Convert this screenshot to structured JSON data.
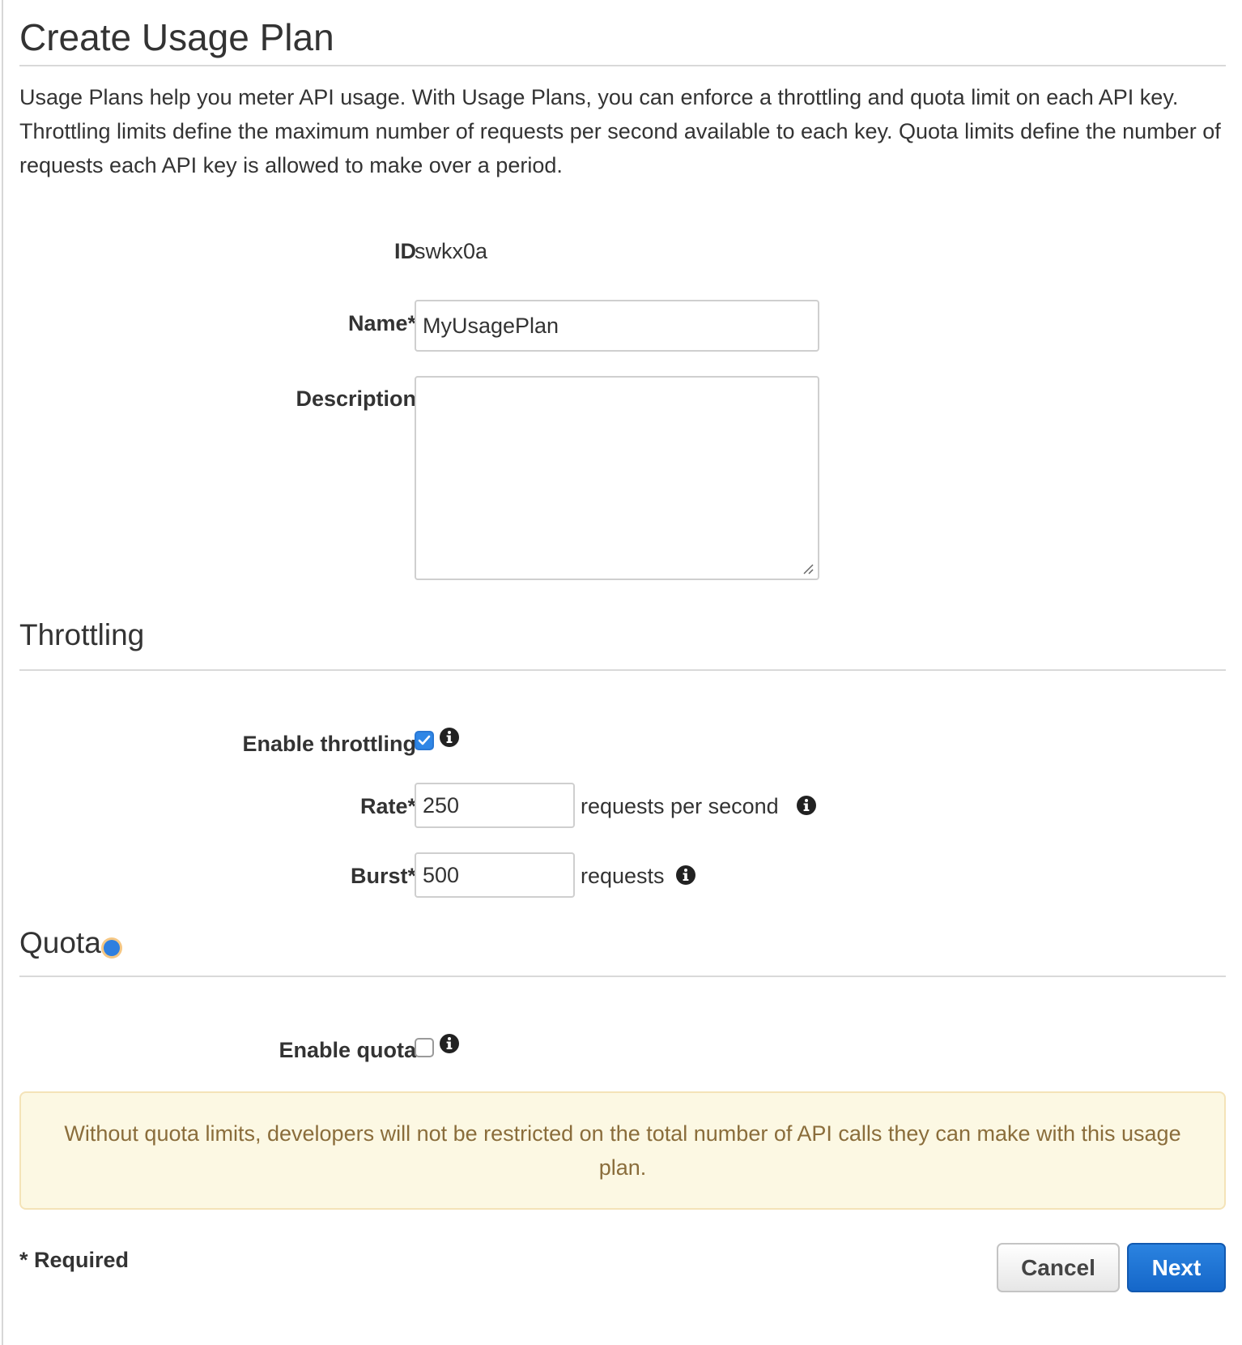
{
  "page": {
    "title": "Create Usage Plan",
    "intro": "Usage Plans help you meter API usage. With Usage Plans, you can enforce a throttling and quota limit on each API key. Throttling limits define the maximum number of requests per second available to each key. Quota limits define the number of requests each API key is allowed to make over a period."
  },
  "details": {
    "id_label": "ID",
    "id_value": "swkx0a",
    "name_label": "Name*",
    "name_value": "MyUsagePlan",
    "description_label": "Description",
    "description_value": ""
  },
  "throttling": {
    "title": "Throttling",
    "enable_label": "Enable throttling",
    "enabled": true,
    "rate_label": "Rate*",
    "rate_value": "250",
    "rate_suffix": "requests per second",
    "burst_label": "Burst*",
    "burst_value": "500",
    "burst_suffix": "requests"
  },
  "quota": {
    "title": "Quota",
    "enable_label": "Enable quota",
    "enabled": false,
    "warning": "Without quota limits, developers will not be restricted on the total number of API calls they can make with this usage plan."
  },
  "footer": {
    "required_note": "* Required",
    "cancel_label": "Cancel",
    "next_label": "Next"
  },
  "colors": {
    "primary_button": "#1a6fd1",
    "checkbox_checked": "#2f86e6",
    "warning_background": "#fcf8e3",
    "warning_text": "#8a6d3b"
  },
  "icons": {
    "info": "info-circle-icon",
    "check": "check-icon",
    "status": "status-dot-icon"
  }
}
